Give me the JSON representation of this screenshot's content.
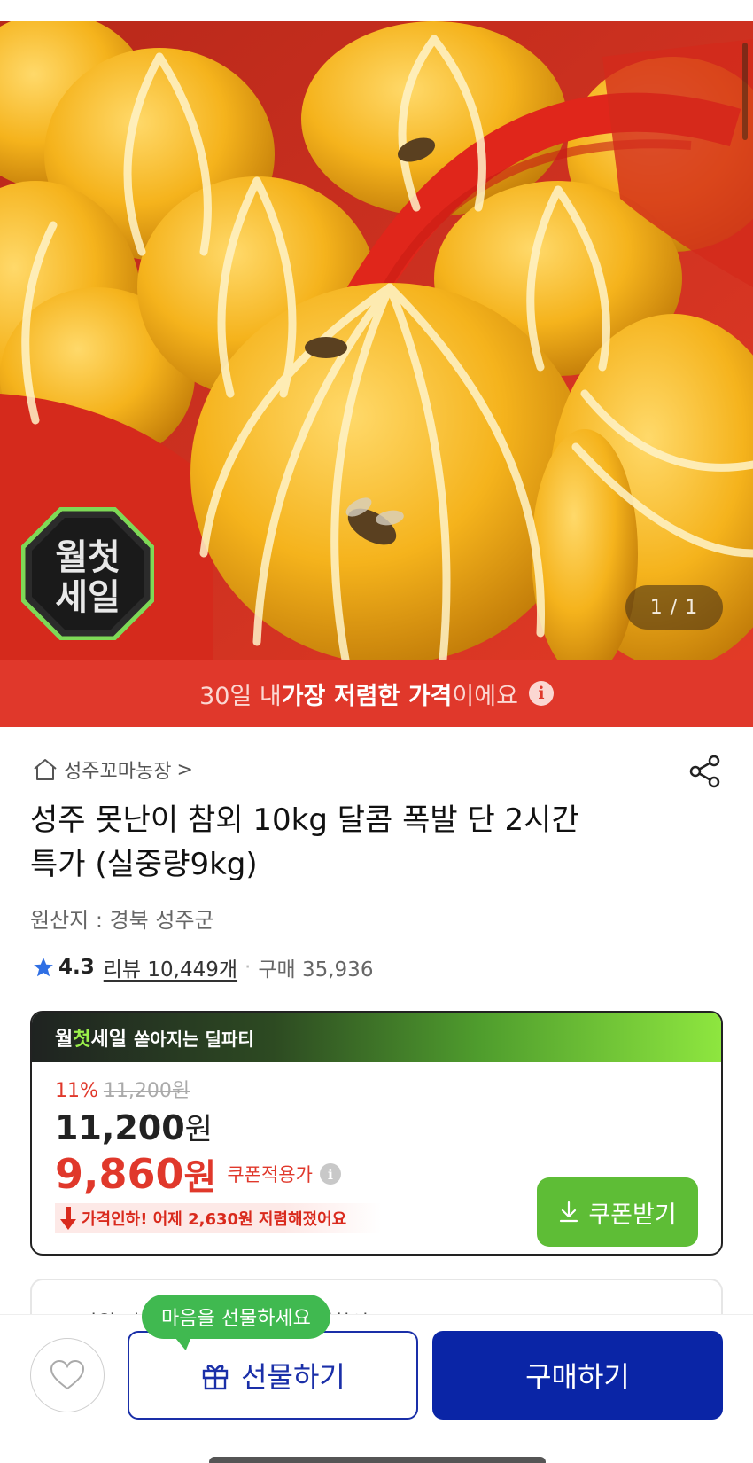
{
  "hero": {
    "page_counter": "1 / 1",
    "sale_logo_text_top": "월첫",
    "sale_logo_text_bottom": "세일"
  },
  "price_banner": {
    "prefix": "30일 내 ",
    "highlight": "가장 저렴한 가격",
    "suffix": "이에요",
    "info_icon": "info-icon"
  },
  "store": {
    "name": "성주꼬마농장",
    "chevron": ">"
  },
  "product": {
    "title_line1": "성주 못난이 참외 10kg 달콤 폭발 단 2시간",
    "title_line2": "특가 (실중량9kg)",
    "origin": "원산지 : 경북 성주군"
  },
  "rating": {
    "score": "4.3",
    "review_text": "리뷰 10,449개",
    "purchase_text": "구매 35,936"
  },
  "deal": {
    "brand_part1": "월",
    "brand_part2": "첫",
    "brand_part3": "세일",
    "subtitle": "쏟아지는 딜파티",
    "discount_rate": "11%",
    "original_price": "11,200원",
    "price_number": "11,200",
    "price_unit": "원",
    "coupon_price_number": "9,860",
    "coupon_price_unit": "원",
    "coupon_label": "쿠폰적용가",
    "price_drop_text": "가격인하! 어제 2,630원 저렴해졌어요",
    "coupon_button_label": "쿠폰받기"
  },
  "next_card": {
    "partial_text": "20만원 이상 구매 시 최대 ... 결제할인"
  },
  "bottom_bar": {
    "gift_tooltip": "마음을 선물하세요",
    "gift_button_label": "선물하기",
    "buy_button_label": "구매하기"
  },
  "colors": {
    "accent_red": "#e0382b",
    "accent_green": "#5ebd36",
    "primary_blue": "#0a25a6"
  }
}
